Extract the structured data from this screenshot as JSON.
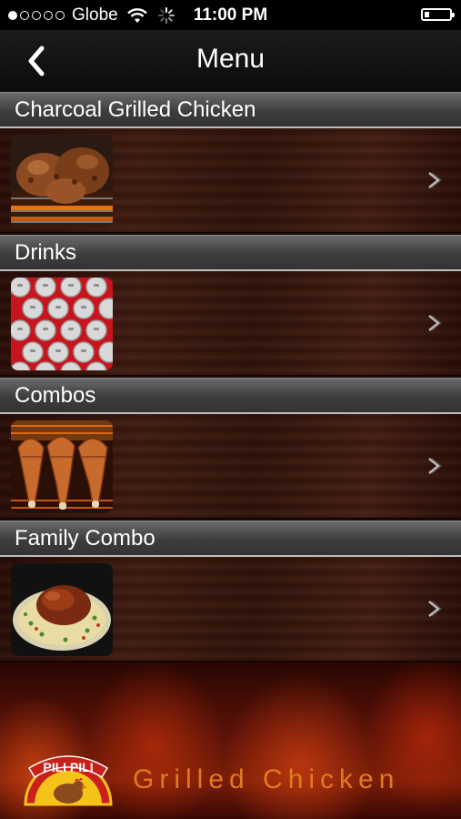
{
  "status": {
    "carrier": "Globe",
    "time": "11:00 PM",
    "signal_bars_filled": 1,
    "signal_bars_total": 5,
    "battery_level": 0.2
  },
  "nav": {
    "title": "Menu",
    "back_icon": "chevron-left-icon"
  },
  "sections": [
    {
      "title": "Charcoal Grilled Chicken",
      "thumbnail": "grilled-chicken-image"
    },
    {
      "title": "Drinks",
      "thumbnail": "soda-cans-image"
    },
    {
      "title": "Combos",
      "thumbnail": "chicken-legs-image"
    },
    {
      "title": "Family Combo",
      "thumbnail": "family-combo-image"
    }
  ],
  "footer": {
    "logo_text": "PILI PILI",
    "tagline": "Grilled Chicken"
  },
  "colors": {
    "tagline": "#e07a20",
    "logo_red": "#c8201a",
    "logo_yellow": "#f5c21a"
  }
}
